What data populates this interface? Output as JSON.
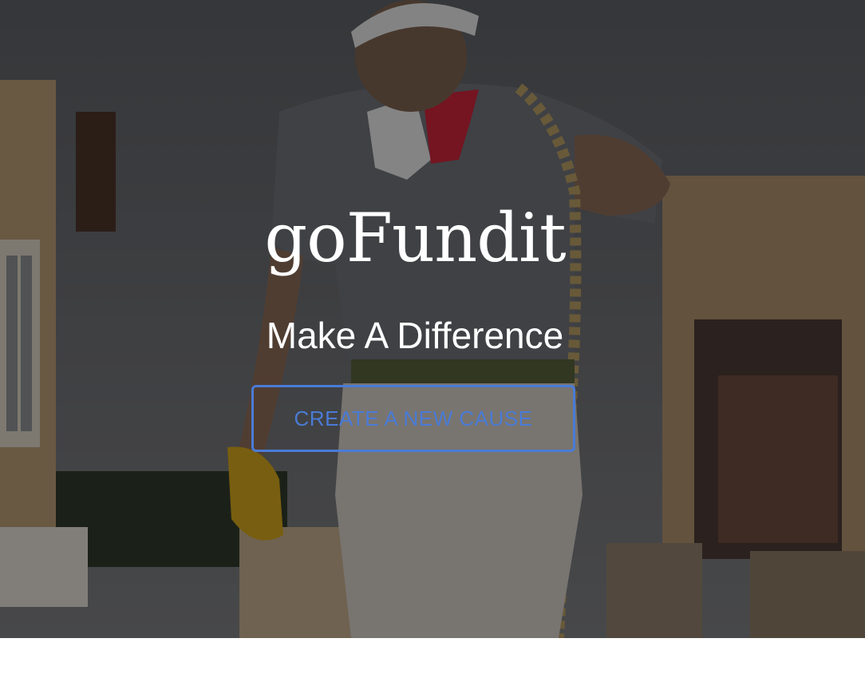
{
  "hero": {
    "brand": "goFundit",
    "tagline": "Make A Difference",
    "cta_label": "CREATE A NEW CAUSE"
  },
  "colors": {
    "accent": "#4a7bd6",
    "text": "#ffffff",
    "overlay": "#000000"
  }
}
